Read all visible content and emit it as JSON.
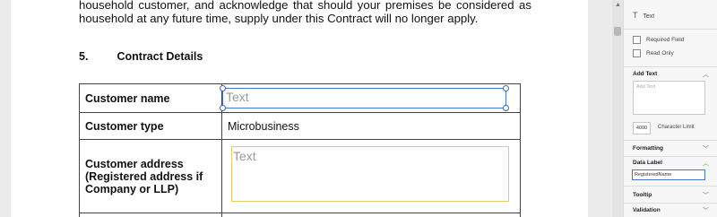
{
  "document": {
    "paragraph": "household customer, and acknowledge that should your premises be considered as household at any future time, supply under this Contract will no longer apply.",
    "section": {
      "number": "5.",
      "title": "Contract Details"
    },
    "rows": [
      {
        "label": "Customer name",
        "field_placeholder": "Text"
      },
      {
        "label": "Customer type",
        "value": "Microbusiness"
      },
      {
        "label": "Customer address (Registered address if Company or LLP)",
        "field_placeholder": "Text"
      }
    ]
  },
  "panel": {
    "field_type": "Text",
    "required_label": "Required Field",
    "readonly_label": "Read Only",
    "add_text": {
      "title": "Add Text",
      "placeholder": "Add Text",
      "char_limit_value": "4000",
      "char_limit_label": "Character Limit"
    },
    "formatting_title": "Formatting",
    "data_label": {
      "title": "Data Label",
      "value": "RegisteredName"
    },
    "tooltip_title": "Tooltip",
    "validation_title": "Validation"
  },
  "colors": {
    "selected_field_border": "#4a78c8",
    "field_border": "#e8c66a"
  }
}
